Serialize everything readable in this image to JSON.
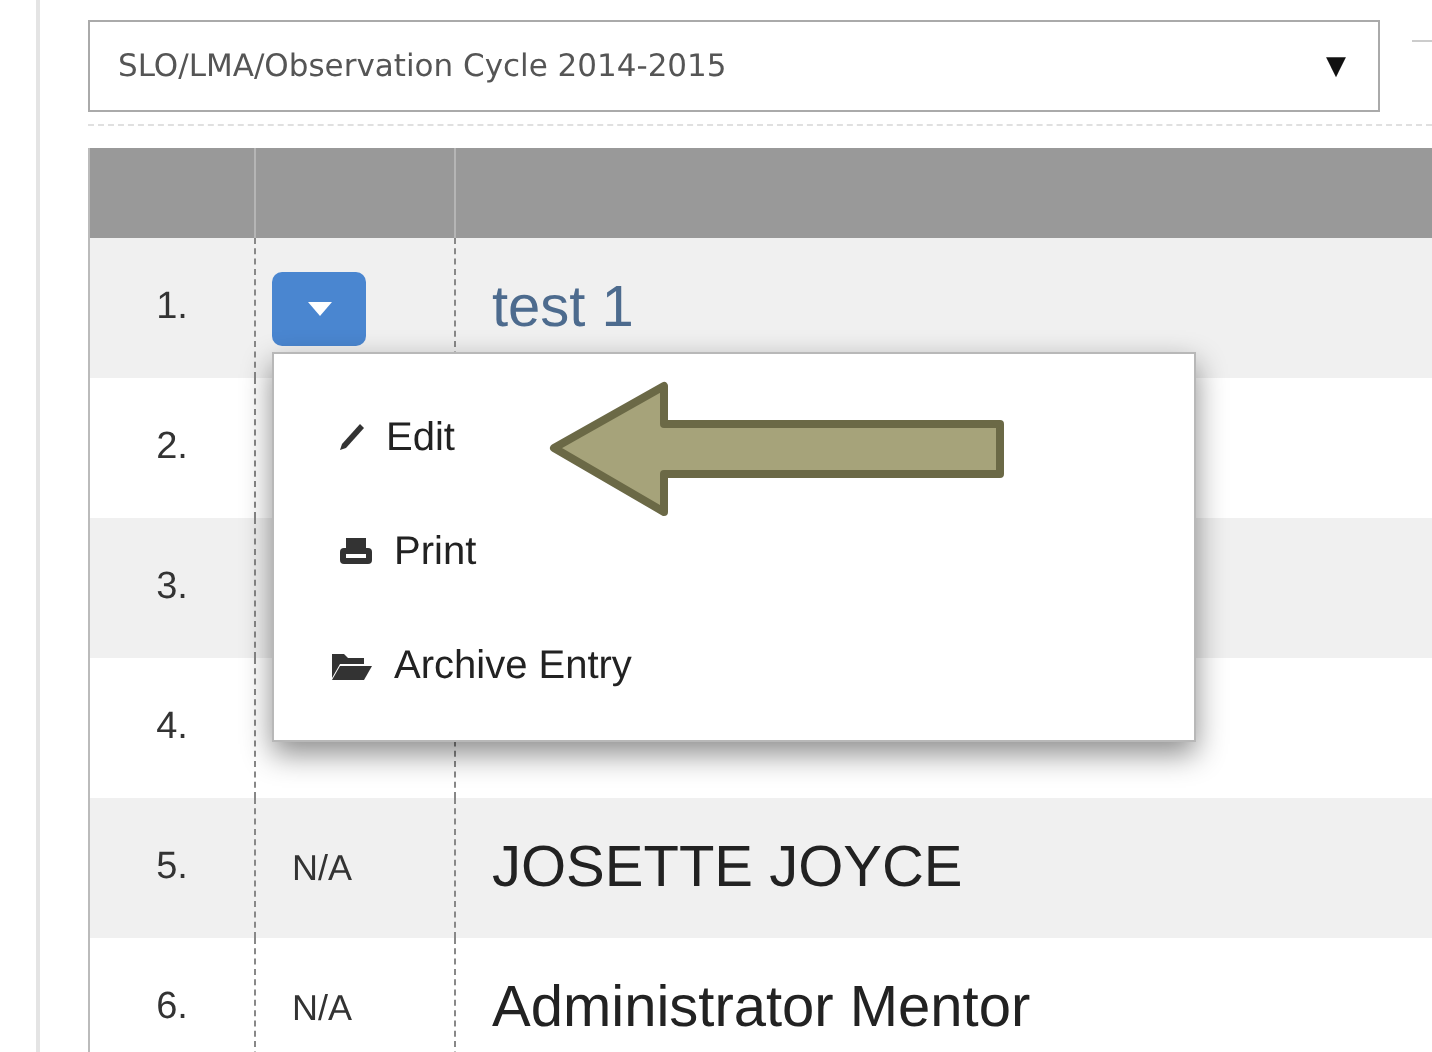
{
  "cycle_select": {
    "value": "SLO/LMA/Observation Cycle 2014-2015",
    "caret": "▼"
  },
  "table": {
    "rows": [
      {
        "number": "1.",
        "cell_2": {
          "kind": "menu_button",
          "expanded": true
        },
        "name": "test 1",
        "link": true
      },
      {
        "number": "2."
      },
      {
        "number": "3."
      },
      {
        "number": "4."
      },
      {
        "number": "5.",
        "cell_2": {
          "kind": "text",
          "text": "N/A"
        },
        "name": "JOSETTE JOYCE",
        "link": false
      },
      {
        "number": "6.",
        "cell_2": {
          "kind": "text",
          "text": "N/A"
        },
        "name": "Administrator Mentor",
        "link": false
      }
    ]
  },
  "row_menu": {
    "items": [
      {
        "label": "Edit",
        "highlighted": true
      },
      {
        "label": "Print",
        "highlighted": false
      },
      {
        "label": "Archive Entry",
        "highlighted": false
      }
    ]
  }
}
